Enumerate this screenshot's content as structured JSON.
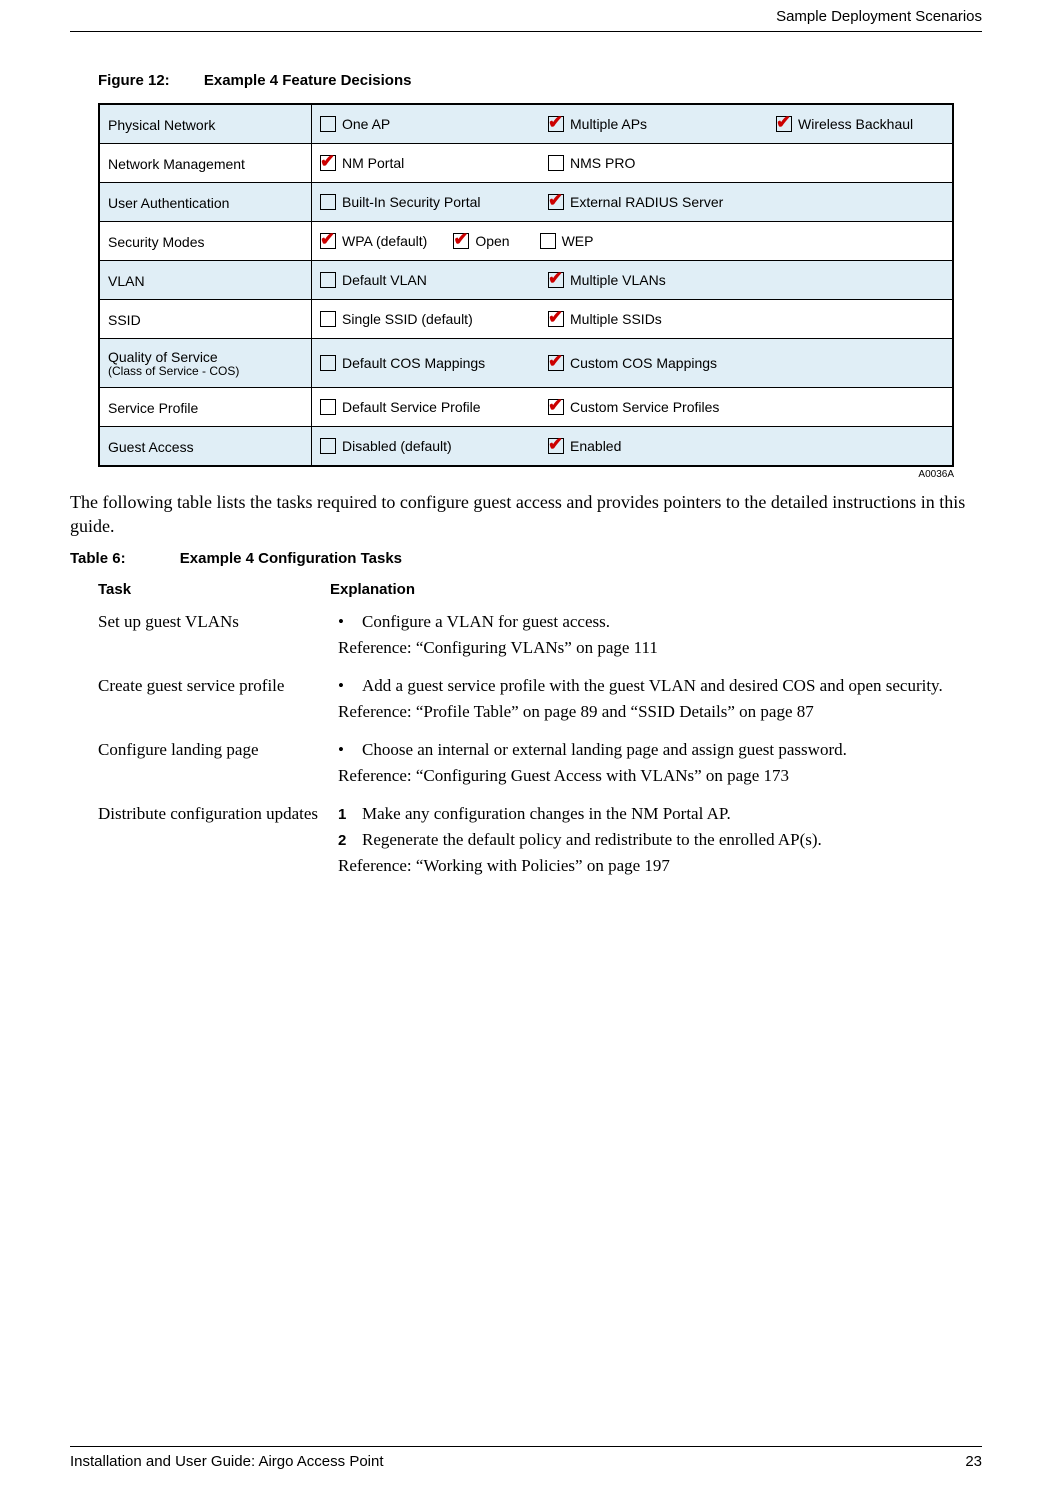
{
  "header": {
    "section": "Sample Deployment Scenarios"
  },
  "figure": {
    "number": "Figure 12:",
    "title": "Example 4 Feature Decisions",
    "artid": "A0036A",
    "rows": [
      {
        "label": "Physical Network",
        "shaded": true,
        "options": [
          {
            "label": "One AP",
            "checked": false
          },
          {
            "label": "Multiple APs",
            "checked": true
          },
          {
            "label": "Wireless Backhaul",
            "checked": true
          }
        ]
      },
      {
        "label": "Network Management",
        "shaded": false,
        "options": [
          {
            "label": "NM Portal",
            "checked": true
          },
          {
            "label": "NMS PRO",
            "checked": false
          }
        ]
      },
      {
        "label": "User Authentication",
        "shaded": true,
        "options": [
          {
            "label": "Built-In Security Portal",
            "checked": false
          },
          {
            "label": "External RADIUS Server",
            "checked": true
          }
        ]
      },
      {
        "label": "Security Modes",
        "shaded": false,
        "options": [
          {
            "label": "WPA (default)",
            "checked": true
          },
          {
            "label": "Open",
            "checked": true
          },
          {
            "label": "WEP",
            "checked": false
          }
        ]
      },
      {
        "label": "VLAN",
        "shaded": true,
        "options": [
          {
            "label": "Default VLAN",
            "checked": false
          },
          {
            "label": "Multiple VLANs",
            "checked": true
          }
        ]
      },
      {
        "label": "SSID",
        "shaded": false,
        "options": [
          {
            "label": "Single SSID (default)",
            "checked": false
          },
          {
            "label": "Multiple SSIDs",
            "checked": true
          }
        ]
      },
      {
        "label": "Quality of Service",
        "sublabel": "(Class of Service - COS)",
        "shaded": true,
        "options": [
          {
            "label": "Default COS Mappings",
            "checked": false
          },
          {
            "label": "Custom COS Mappings",
            "checked": true
          }
        ]
      },
      {
        "label": "Service Profile",
        "shaded": false,
        "options": [
          {
            "label": "Default Service Profile",
            "checked": false
          },
          {
            "label": "Custom Service Profiles",
            "checked": true
          }
        ]
      },
      {
        "label": "Guest Access",
        "shaded": true,
        "options": [
          {
            "label": "Disabled (default)",
            "checked": false
          },
          {
            "label": "Enabled",
            "checked": true
          }
        ]
      }
    ]
  },
  "intro": "The following table lists the tasks required to configure guest access and provides pointers to the detailed instructions in this guide.",
  "table": {
    "number": "Table 6:",
    "title": "Example 4 Configuration Tasks",
    "head": {
      "task": "Task",
      "expl": "Explanation"
    },
    "rows": [
      {
        "task": "Set up guest VLANs",
        "items": [
          {
            "type": "bullet",
            "text": "Configure a VLAN for guest access."
          }
        ],
        "ref": "Reference: “Configuring VLANs” on page 111"
      },
      {
        "task": "Create guest service profile",
        "items": [
          {
            "type": "bullet",
            "text": "Add a guest service profile with the guest VLAN and desired COS and open security."
          }
        ],
        "ref": "Reference: “Profile Table” on page 89 and “SSID Details” on page 87"
      },
      {
        "task": "Configure landing page",
        "items": [
          {
            "type": "bullet",
            "text": "Choose an internal or external landing page and assign guest password."
          }
        ],
        "ref": "Reference: “Configuring Guest Access with VLANs” on page 173"
      },
      {
        "task": "Distribute configuration updates",
        "items": [
          {
            "type": "num",
            "n": "1",
            "text": "Make any configuration changes in the NM Portal AP."
          },
          {
            "type": "num",
            "n": "2",
            "text": "Regenerate the default policy and redistribute to the enrolled AP(s)."
          }
        ],
        "ref": "Reference: “Working with Policies” on page 197"
      }
    ]
  },
  "footer": {
    "left": "Installation and User Guide: Airgo Access Point",
    "right": "23"
  }
}
